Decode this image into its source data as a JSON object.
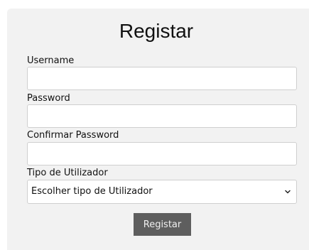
{
  "form": {
    "title": "Registar",
    "username": {
      "label": "Username",
      "value": ""
    },
    "password": {
      "label": "Password",
      "value": ""
    },
    "confirm_password": {
      "label": "Confirmar Password",
      "value": ""
    },
    "user_type": {
      "label": "Tipo de Utilizador",
      "selected": "Escolher tipo de Utilizador"
    },
    "submit_label": "Registar"
  },
  "colors": {
    "card_background": "#f2f2f2",
    "button_background": "#5e5e5e",
    "button_text": "#f0f0f0"
  },
  "icons": {
    "select_chevron": "chevron-down-icon"
  }
}
